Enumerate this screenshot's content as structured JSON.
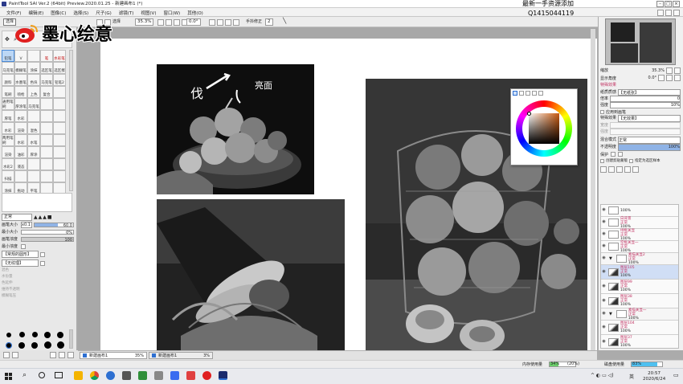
{
  "window": {
    "title": "PaintTool SAI Ver.2 (64bit) Preview.2020.01.25 - 新建画布1 (*)",
    "overlay_line1": "最新一手资源添加",
    "overlay_line2": "Q1415044119"
  },
  "watermark": {
    "text": "墨心绘意"
  },
  "menu": [
    "文件(F)",
    "编辑(E)",
    "图像(C)",
    "选择(S)",
    "尺子(G)",
    "滤镜(T)",
    "视图(V)",
    "窗口(W)",
    "其他(O)"
  ],
  "toolbar": {
    "mode": "选择",
    "zoom_value": "35.3%",
    "rotation_value": "0.0°",
    "ruler_label": "手抖修正",
    "stabilizer_value": "2",
    "select_label": "选择"
  },
  "tools": [
    {
      "label": "铅笔",
      "red": false
    },
    {
      "label": "V",
      "red": false
    },
    {
      "label": "",
      "red": false
    },
    {
      "label": "笔",
      "red": true
    },
    {
      "label": "水彩笔",
      "red": true
    },
    {
      "label": "马克笔",
      "red": false
    },
    {
      "label": "模糊笔",
      "red": false
    },
    {
      "label": "涂抹",
      "red": false
    },
    {
      "label": "选区笔",
      "red": false
    },
    {
      "label": "选区擦",
      "red": false
    },
    {
      "label": "颜料",
      "red": false
    },
    {
      "label": "水墨笔",
      "red": false
    },
    {
      "label": "色块",
      "red": false
    },
    {
      "label": "马克笔",
      "red": false
    },
    {
      "label": "铅笔2",
      "red": false
    },
    {
      "label": "笔刷",
      "red": false
    },
    {
      "label": "喷枪",
      "red": false
    },
    {
      "label": "上色",
      "red": false
    },
    {
      "label": "复合",
      "red": false
    },
    {
      "label": "",
      "red": false
    },
    {
      "label": "通用笔刷",
      "red": false
    },
    {
      "label": "厚涂笔",
      "red": false
    },
    {
      "label": "马克笔",
      "red": false
    },
    {
      "label": "",
      "red": false
    },
    {
      "label": "",
      "red": false
    },
    {
      "label": "厚笔",
      "red": false
    },
    {
      "label": "水彩",
      "red": false
    },
    {
      "label": "",
      "red": false
    },
    {
      "label": "",
      "red": false
    },
    {
      "label": "",
      "red": false
    },
    {
      "label": "水彩",
      "red": false
    },
    {
      "label": "渲染",
      "red": false
    },
    {
      "label": "混色",
      "red": false
    },
    {
      "label": "",
      "red": false
    },
    {
      "label": "",
      "red": false
    },
    {
      "label": "两用笔刷",
      "red": false
    },
    {
      "label": "水彩",
      "red": false
    },
    {
      "label": "水笔",
      "red": false
    },
    {
      "label": "",
      "red": false
    },
    {
      "label": "",
      "red": false
    },
    {
      "label": "渲染",
      "red": false
    },
    {
      "label": "油彩",
      "red": false
    },
    {
      "label": "厚涂",
      "red": false
    },
    {
      "label": "",
      "red": false
    },
    {
      "label": "",
      "red": false
    },
    {
      "label": "水彩2",
      "red": false
    },
    {
      "label": "液态",
      "red": false
    },
    {
      "label": "",
      "red": false
    },
    {
      "label": "",
      "red": false
    },
    {
      "label": "",
      "red": false
    },
    {
      "label": "扫描",
      "red": false
    },
    {
      "label": "",
      "red": false
    },
    {
      "label": "",
      "red": false
    },
    {
      "label": "",
      "red": false
    },
    {
      "label": "",
      "red": false
    },
    {
      "label": "涂抹",
      "red": false
    },
    {
      "label": "拖动",
      "red": false
    },
    {
      "label": "平笔",
      "red": false
    },
    {
      "label": "",
      "red": false
    },
    {
      "label": "",
      "red": false
    }
  ],
  "brush_settings": {
    "mode": "正常",
    "size_label": "画笔大小",
    "size_mult": "x0.1",
    "size_value": "60.0",
    "min_size_label": "最小大小",
    "min_size_value": "0%",
    "density_label": "画笔浓度",
    "density_value": "100",
    "min_density_label": "最小浓度",
    "shape": "【常规的圆形】",
    "texture": "【无纹理】",
    "section_blend": "混色",
    "section_dilute": "水份量",
    "section_keep": "色延伸",
    "opt1": "维持不透明",
    "opt2": "模糊笔压"
  },
  "canvas": {
    "page_number": "1"
  },
  "tabs": [
    {
      "label": "新建画布1",
      "zoom": "35%"
    },
    {
      "label": "新建画布1",
      "zoom": "3%"
    }
  ],
  "navigator": {
    "zoom_label": "缩放",
    "zoom_value": "35.3%",
    "rotate_label": "显示角度",
    "rotate_value": "0.0°"
  },
  "effects": {
    "title": "特殊效果",
    "texture_label": "纸质质感",
    "texture_value": "【无纸张】",
    "scale_label": "倍率",
    "scale_value": "0",
    "strength_label": "强度",
    "strength_value": "10%",
    "apply_label": "应用到画笔",
    "effect_label": "特殊效果",
    "effect_value": "【无效果】",
    "width_label": "宽度",
    "strength2_label": "强度"
  },
  "layer_props": {
    "blend_label": "混合模式",
    "blend_value": "正常",
    "opacity_label": "不透明度",
    "opacity_value": "100%",
    "protect_label": "保护",
    "clip_label": "创建剪贴蒙版",
    "sample_label": "指定为选区样本"
  },
  "layers": [
    {
      "name": "",
      "mode": "",
      "opacity": "100%",
      "thumb": false,
      "folder": false
    },
    {
      "name": "白背景",
      "mode": "正常",
      "opacity": "100%",
      "thumb": false,
      "folder": false
    },
    {
      "name": "绿框关显",
      "mode": "正常",
      "opacity": "100%",
      "thumb": false,
      "folder": false
    },
    {
      "name": "空框关显一",
      "mode": "正常",
      "opacity": "100%",
      "thumb": false,
      "folder": false
    },
    {
      "name": "素描关显2",
      "mode": "正常",
      "opacity": "100%",
      "thumb": false,
      "folder": true
    },
    {
      "name": "图层105",
      "mode": "正常",
      "opacity": "100%",
      "thumb": true,
      "folder": false
    },
    {
      "name": "图层99",
      "mode": "正常",
      "opacity": "100%",
      "thumb": true,
      "folder": false
    },
    {
      "name": "图层38",
      "mode": "正常",
      "opacity": "100%",
      "thumb": true,
      "folder": false
    },
    {
      "name": "素描关显一",
      "mode": "正常",
      "opacity": "100%",
      "thumb": false,
      "folder": true
    },
    {
      "name": "图层104",
      "mode": "正常",
      "opacity": "100%",
      "thumb": true,
      "folder": false
    },
    {
      "name": "图层37",
      "mode": "正常",
      "opacity": "100%",
      "thumb": true,
      "folder": false
    }
  ],
  "status": {
    "memory_label": "内存使用量",
    "memory_pct": "34%",
    "memory_detail": "(20%)",
    "disk_label": "磁盘使用量",
    "disk_pct": "83%",
    "memory_fill": 0.34,
    "disk_fill": 0.83
  },
  "clock": {
    "time": "20:57",
    "date": "2020/6/24",
    "ime": "英"
  },
  "colors": {
    "accent": "#2d6fd1",
    "layer_pink": "#c03060",
    "tool_red": "#c00000",
    "weibo_red": "#e02020"
  },
  "annotations": {
    "left": "伐",
    "right": "亮面"
  }
}
